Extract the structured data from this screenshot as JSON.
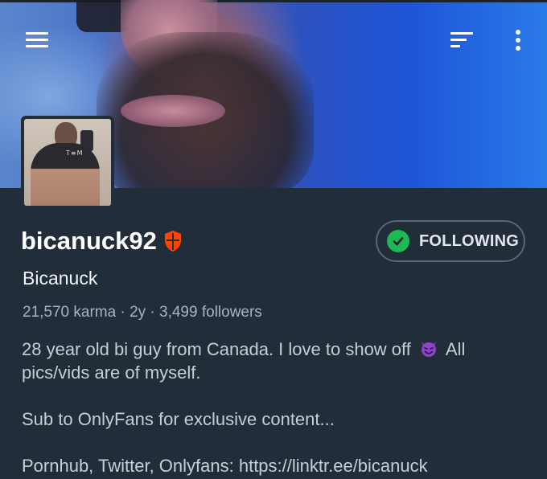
{
  "header": {
    "menu_icon": "hamburger-menu-icon",
    "sort_icon": "sort-icon",
    "more_icon": "more-vertical-icon"
  },
  "profile": {
    "username": "bicanuck92",
    "moderator_badge_icon": "moderator-shield-icon",
    "display_name": "Bicanuck",
    "stats": "21,570 karma · 2y · 3,499 followers",
    "follow_button": {
      "label": "FOLLOWING",
      "icon": "check-circle-icon"
    },
    "bio": {
      "line1_before_emoji": "28 year old bi guy from Canada. I love to show off",
      "emoji": "smiling-devil-emoji",
      "line1_after_emoji": "All pics/vids are of myself.",
      "line2": "Sub to OnlyFans for exclusive content...",
      "line3": "Pornhub, Twitter, Onlyfans: https://linktr.ee/bicanuck"
    }
  },
  "colors": {
    "background": "#222d3a",
    "following_check": "#1db954",
    "mod_badge": "#ff4500",
    "emoji_purple": "#8e44c9"
  }
}
